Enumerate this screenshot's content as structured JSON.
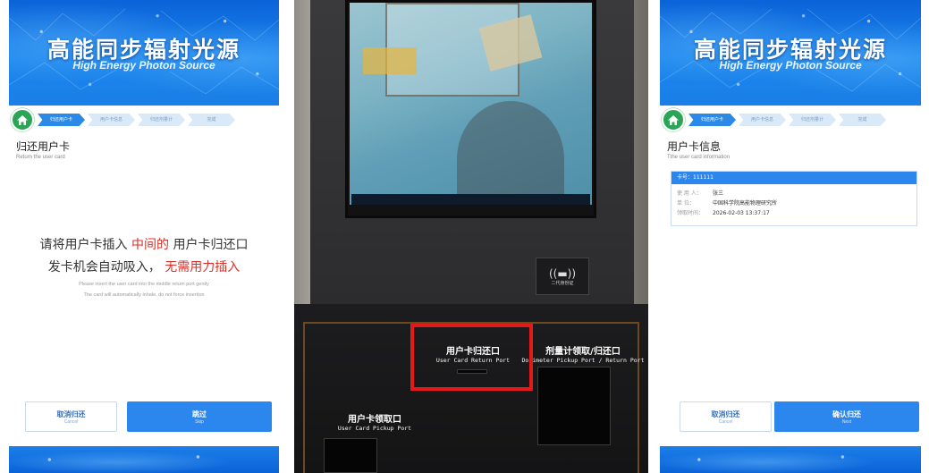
{
  "banner": {
    "title": "高能同步辐射光源",
    "subtitle": "High Energy Photon Source"
  },
  "steps": [
    "归还用户卡",
    "用户卡信息",
    "归还剂量计",
    "完成"
  ],
  "left_screen": {
    "title": "归还用户卡",
    "subtitle": "Return the user card",
    "msg_line1_a": "请将用户卡插入",
    "msg_line1_b": "中间的",
    "msg_line1_c": "用户卡归还口",
    "msg_line2_a": "发卡机会自动吸入，",
    "msg_line2_b": "无需用力插入",
    "msg_en_1": "Please insert the user card into the middle return port gently",
    "msg_en_2": "The card will automatically inhale, do not force insertion",
    "cancel_cn": "取消归还",
    "cancel_en": "Cancel",
    "skip_cn": "跳过",
    "skip_en": "Skip"
  },
  "right_screen": {
    "title": "用户卡信息",
    "subtitle": "Tthe user card information",
    "card_header": "卡号：111111",
    "rows": [
      {
        "k": "使 用 人：",
        "v": "张三"
      },
      {
        "k": "单    位：",
        "v": "中国科学院高能物理研究所"
      },
      {
        "k": "领取时间：",
        "v": "2026-02-03 13:37:17"
      }
    ],
    "cancel_cn": "取消归还",
    "cancel_en": "Cancel",
    "confirm_cn": "确认归还",
    "confirm_en": "Next"
  },
  "photo": {
    "id_reader_label": "二代身份证",
    "return_port_cn": "用户卡归还口",
    "return_port_en": "User Card Return Port",
    "dosimeter_cn": "剂量计领取/归还口",
    "dosimeter_en": "Dosimeter Pickup Port / Return Port",
    "pickup_cn": "用户卡领取口",
    "pickup_en": "User Card Pickup Port"
  },
  "colors": {
    "brand_blue": "#2b86ee",
    "alert_red": "#d7312a",
    "highlight_box": "#e6191a",
    "home_green": "#2aa556"
  },
  "icons": [
    "home-icon",
    "id-card-reader-icon"
  ]
}
